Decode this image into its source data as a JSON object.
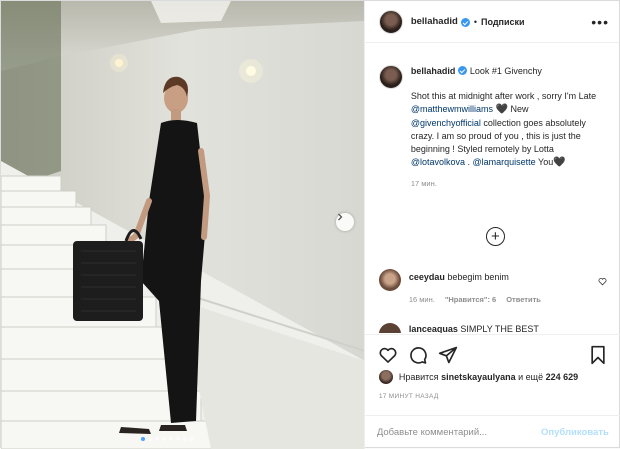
{
  "post": {
    "username": "bellahadid",
    "separator": "•",
    "follow_label": "Подписки",
    "more_label": "•••"
  },
  "caption": {
    "username": "bellahadid",
    "title": "Look #1 Givenchy",
    "segments": {
      "t1": "Shot this at midnight after work , sorry I'm Late ",
      "m1": "@matthewmwilliams",
      "h1": "🖤",
      "t2": " New ",
      "m2": "@givenchyofficial",
      "t3": " collection goes absolutely crazy. I am so proud of you , this is just the beginning ! Styled remotely by Lotta ",
      "m3": "@lotavolkova",
      "t4": " . ",
      "m4": "@lamarquisette",
      "t5": " You",
      "h2": "🖤"
    },
    "time": "17 мин."
  },
  "load_more_label": "+",
  "comments": [
    {
      "username": "ceeydau",
      "text": "bebegim benim",
      "time": "16 мин.",
      "likes_label": "\"Нравится\": 6",
      "reply_label": "Ответить"
    },
    {
      "username": "lanceaquas",
      "text": "SIMPLY THE BEST"
    }
  ],
  "icons": {
    "like": "heart-icon",
    "comment": "comment-icon",
    "share": "share-icon",
    "save": "bookmark-icon",
    "verified": "verified-badge-icon",
    "next": "chevron-right-icon"
  },
  "likes": {
    "prefix": "Нравится",
    "user": "sinetskayaulyana",
    "middle": "и ещё",
    "count": "224 629"
  },
  "posted_ago": "17 МИНУТ НАЗАД",
  "add_comment": {
    "placeholder": "Добавьте комментарий...",
    "publish_label": "Опубликовать"
  },
  "carousel": {
    "slides": 8,
    "active": 1
  },
  "colors": {
    "verified": "#3897f0",
    "link": "#00376b",
    "muted": "#8e8e8e",
    "publish_disabled": "#b2dffc",
    "active_dot": "#4aa3ff"
  }
}
